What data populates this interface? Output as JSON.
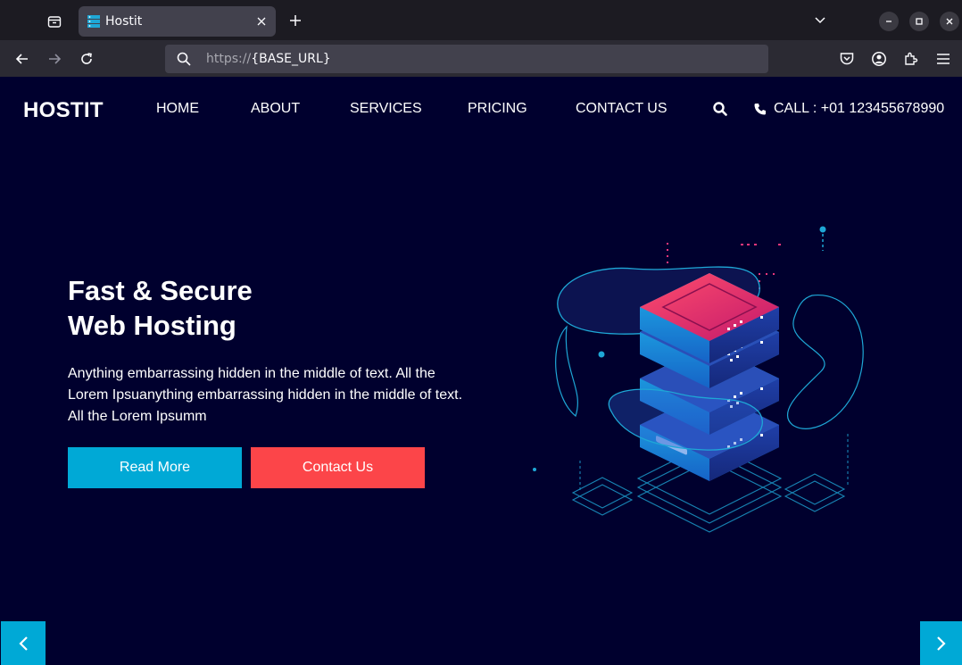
{
  "browser": {
    "tab_title": "Hostit",
    "url_protocol": "https://",
    "url_rest": "{BASE_URL}"
  },
  "site": {
    "logo": "HOSTIT",
    "nav": [
      "HOME",
      "ABOUT",
      "SERVICES",
      "PRICING",
      "CONTACT US"
    ],
    "call": "CALL : +01 123455678990"
  },
  "hero": {
    "title_line1": "Fast & Secure",
    "title_line2": "Web Hosting",
    "text": "Anything embarrassing hidden in the middle of text. All the Lorem Ipsuanything embarrassing hidden in the middle of text. All the Lorem Ipsumm",
    "read_more": "Read More",
    "contact_us": "Contact Us"
  },
  "colors": {
    "background": "#00002e",
    "accent_blue": "#00a9d6",
    "accent_red": "#fc4549"
  }
}
